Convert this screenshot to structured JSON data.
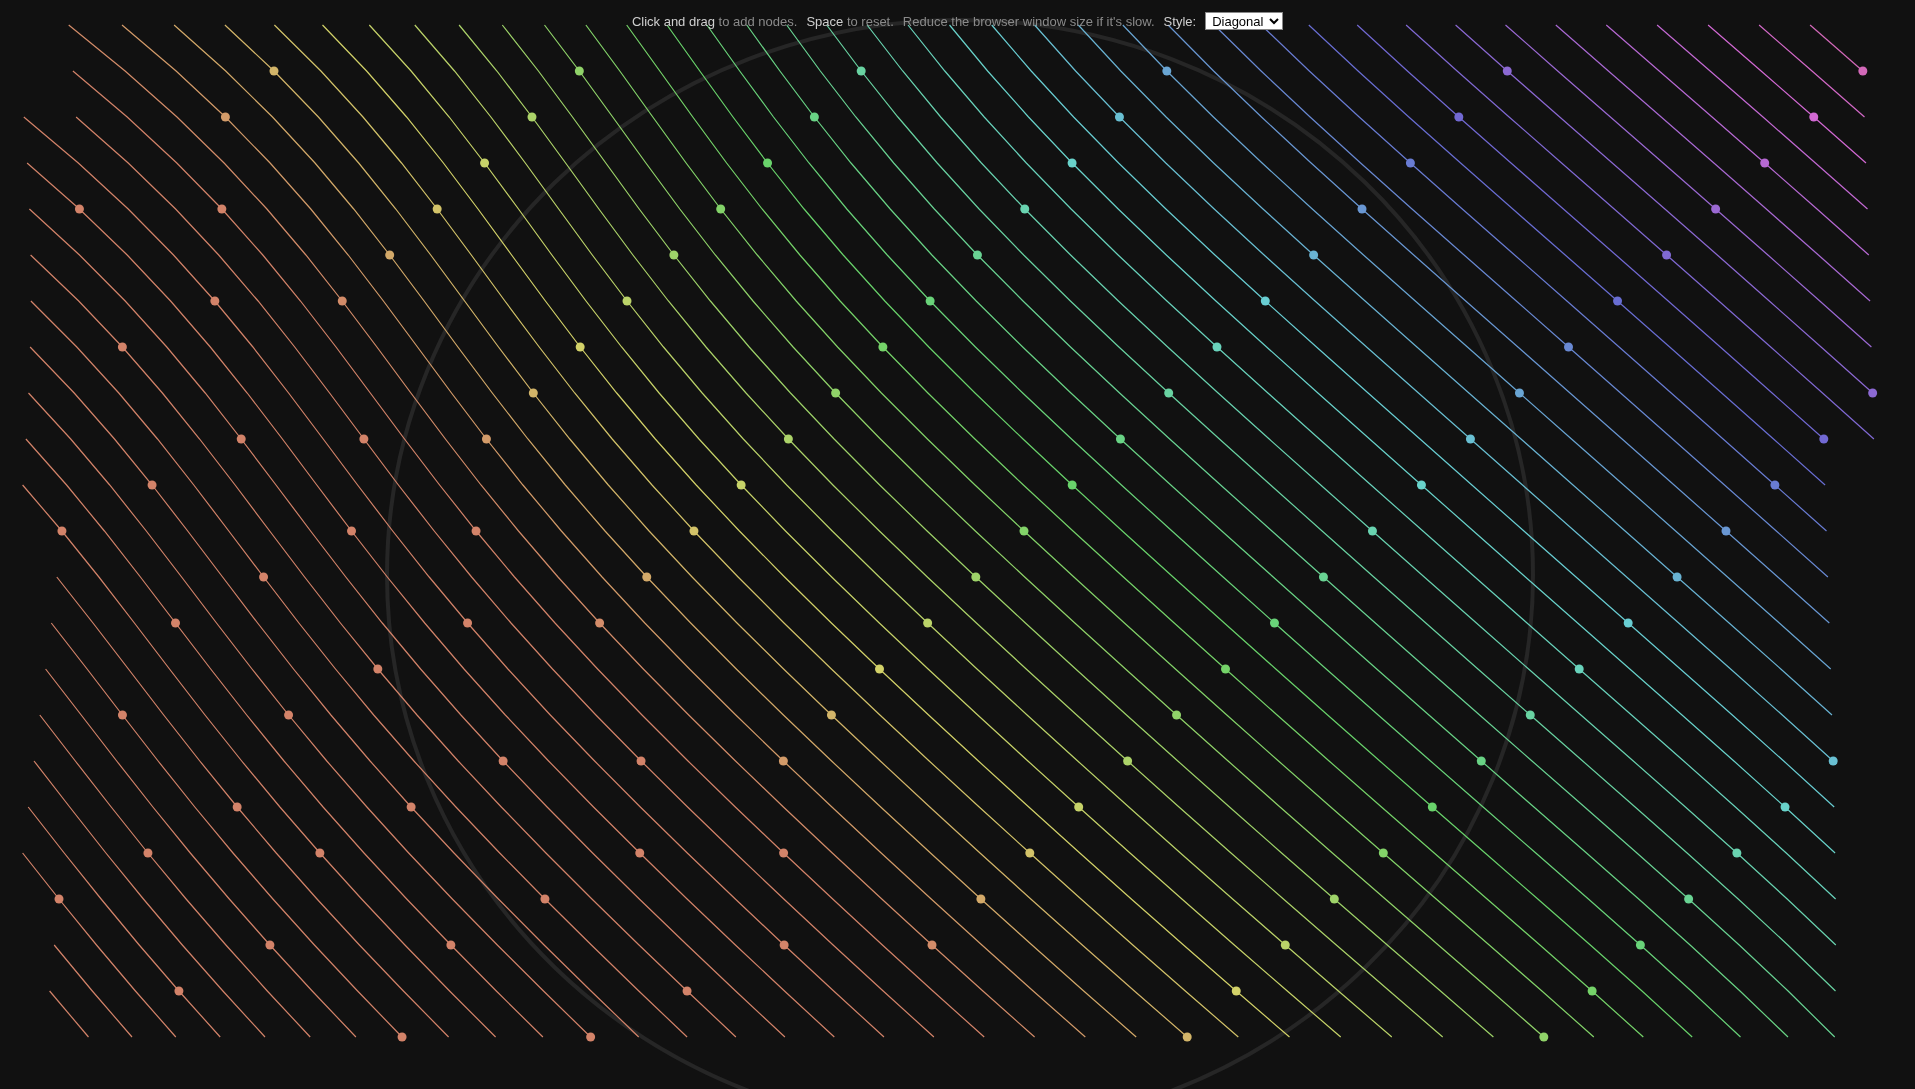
{
  "instructions": [
    {
      "text": "**Click and drag** to add nodes."
    },
    {
      "text": "**Space** to reset."
    },
    {
      "text": "Reduce the browser window size if it's slow."
    }
  ],
  "style_picker": {
    "label": "Style:",
    "value": "Diagonal"
  }
}
